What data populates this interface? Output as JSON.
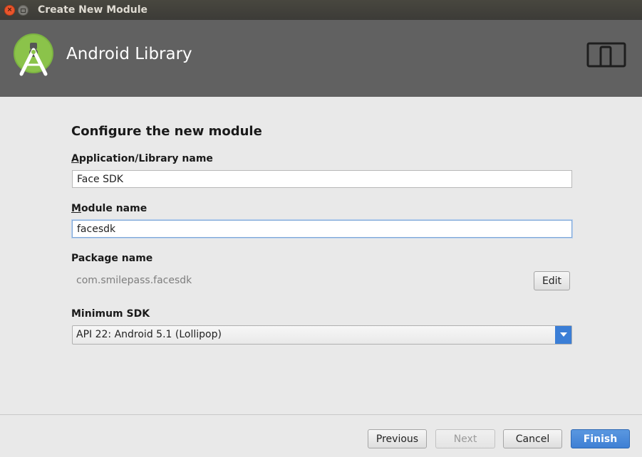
{
  "window": {
    "title": "Create New Module"
  },
  "header": {
    "title": "Android Library",
    "logo_icon": "android-studio-logo-icon",
    "device_icon": "phone-tablet-icon"
  },
  "form": {
    "section_title": "Configure the new module",
    "app_name_label_mnemonic": "A",
    "app_name_label_rest": "pplication/Library name",
    "app_name_value": "Face SDK",
    "module_name_label_mnemonic": "M",
    "module_name_label_rest": "odule name",
    "module_name_value": "facesdk",
    "package_name_label": "Package name",
    "package_name_value": "com.smilepass.facesdk",
    "edit_label": "Edit",
    "min_sdk_label": "Minimum SDK",
    "min_sdk_selected": "API 22: Android 5.1 (Lollipop)"
  },
  "footer": {
    "previous_label": "Previous",
    "next_label": "Next",
    "cancel_label": "Cancel",
    "finish_label": "Finish"
  },
  "colors": {
    "header_bg": "#616161",
    "accent_blue": "#3f80d4",
    "android_green": "#8bc34a"
  }
}
